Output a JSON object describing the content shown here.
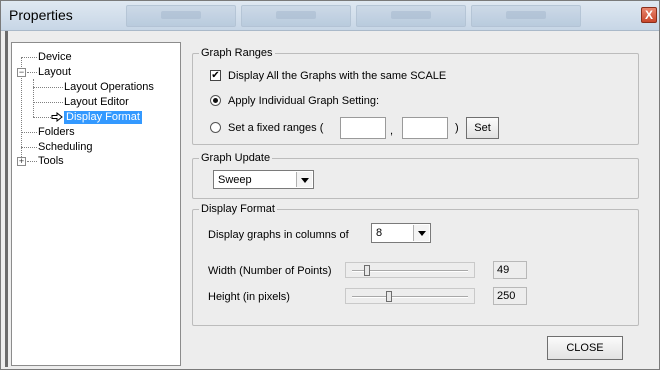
{
  "window": {
    "title": "Properties",
    "close_glyph": "X"
  },
  "tree": {
    "device": "Device",
    "layout": "Layout",
    "layout_operations": "Layout Operations",
    "layout_editor": "Layout Editor",
    "display_format": "Display Format",
    "folders": "Folders",
    "scheduling": "Scheduling",
    "tools": "Tools",
    "expanded_glyph": "−",
    "collapsed_glyph": "+"
  },
  "graph_ranges": {
    "title": "Graph Ranges",
    "same_scale_label": "Display All the Graphs with the same SCALE",
    "same_scale_checked": true,
    "checkmark": "✔",
    "individual_label": "Apply Individual Graph Setting:",
    "fixed_label": "Set a fixed ranges  (",
    "comma": ",",
    "close_paren": ")",
    "min_value": "",
    "max_value": "",
    "set_button": "Set",
    "selected_option": "individual"
  },
  "graph_update": {
    "title": "Graph Update",
    "selected": "Sweep"
  },
  "display_format": {
    "title": "Display Format",
    "columns_label": "Display graphs in columns of",
    "columns_value": "8",
    "width_label": "Width (Number of Points)",
    "width_value": "49",
    "height_label": "Height (in pixels)",
    "height_value": "250"
  },
  "footer": {
    "close_button": "CLOSE"
  },
  "icons": {
    "selected_item_icon": "arrow-right-icon"
  }
}
